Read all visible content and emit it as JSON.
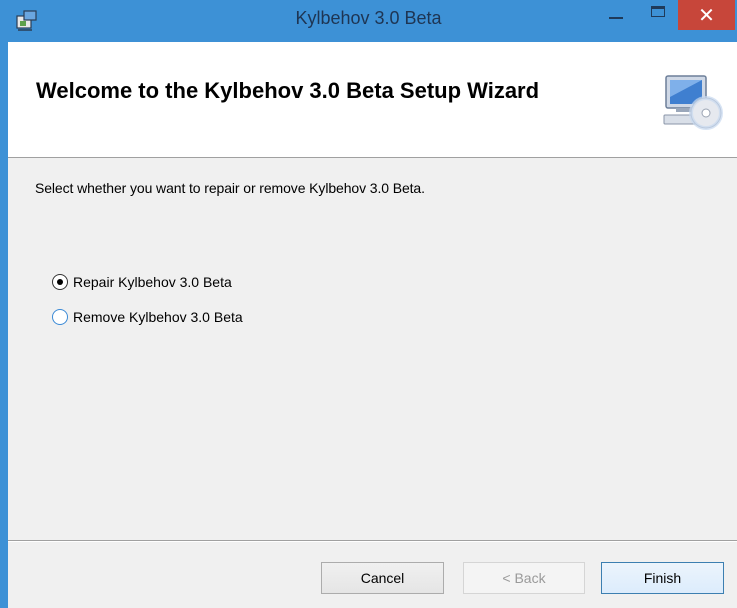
{
  "window": {
    "title": "Kylbehov 3.0 Beta",
    "app_icon": "installer-icon",
    "controls": [
      "minimize-icon",
      "maximize-icon",
      "close-icon"
    ],
    "close_glyph": "✕"
  },
  "header": {
    "title": "Welcome to the Kylbehov 3.0 Beta Setup Wizard",
    "icon": "computer-cd-icon"
  },
  "body": {
    "instruction": "Select whether you want to repair or remove Kylbehov 3.0 Beta.",
    "options": [
      {
        "label": "Repair Kylbehov 3.0 Beta",
        "selected": true
      },
      {
        "label": "Remove Kylbehov 3.0 Beta",
        "selected": false
      }
    ]
  },
  "buttons": {
    "cancel": "Cancel",
    "back": "< Back",
    "finish": "Finish"
  },
  "colors": {
    "titlebar": "#3d91d6",
    "close_button": "#c7463a",
    "dialog_background": "#f0f0f0"
  }
}
